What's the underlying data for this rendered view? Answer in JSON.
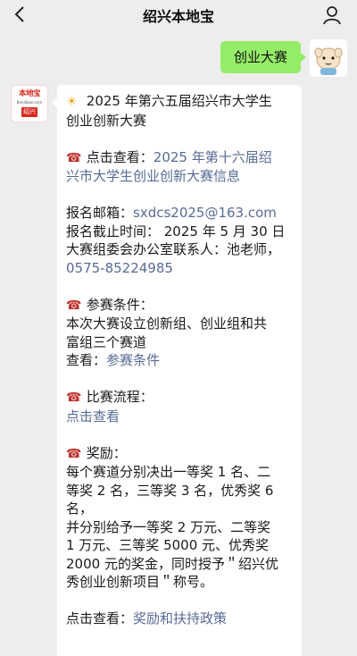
{
  "header": {
    "title": "绍兴本地宝"
  },
  "outgoing": {
    "text": "创业大赛"
  },
  "incoming": {
    "avatar": {
      "logo_text": "本地宝",
      "logo_sub": "Bendibao.com",
      "logo_city": "绍兴"
    },
    "icons": {
      "sun": "☀",
      "phone": "☎"
    },
    "lines": {
      "title_1": "2025 年第六五届绍兴市大学生",
      "title_2": "创业创新大赛",
      "check_prefix": "点击查看：",
      "check_link_1": "2025 年第十六届绍",
      "check_link_2": "兴市大学生创业创新大赛信息",
      "email": "报名邮箱：",
      "email_value": "sxdcs2025@163.com",
      "deadline": "报名截止时间： 2025 年 5 月 30 日",
      "contact": "大赛组委会办公室联系人：池老师，",
      "phone_number": "0575-85224985",
      "cond_title": "参赛条件：",
      "cond_1": "本次大赛设立创新组、创业组和共",
      "cond_2": "富组三个赛道",
      "cond_view": "查看：",
      "cond_link": "参赛条件",
      "flow_title": "比赛流程：",
      "flow_link": "点击查看",
      "award_title": "奖励：",
      "award_1": "每个赛道分别决出一等奖 1 名、二",
      "award_2": "等奖 2 名，三等奖 3 名，优秀奖 6",
      "award_3": "名，",
      "award_4": "并分别给予一等奖 2 万元、二等奖",
      "award_5": "1 万元、三等奖 5000 元、优秀奖",
      "award_6": "2000 元的奖金，同时授予＂绍兴优",
      "award_7": "秀创业创新项目＂称号。",
      "policy_prefix": "点击查看：",
      "policy_link": "奖励和扶持政策"
    }
  }
}
